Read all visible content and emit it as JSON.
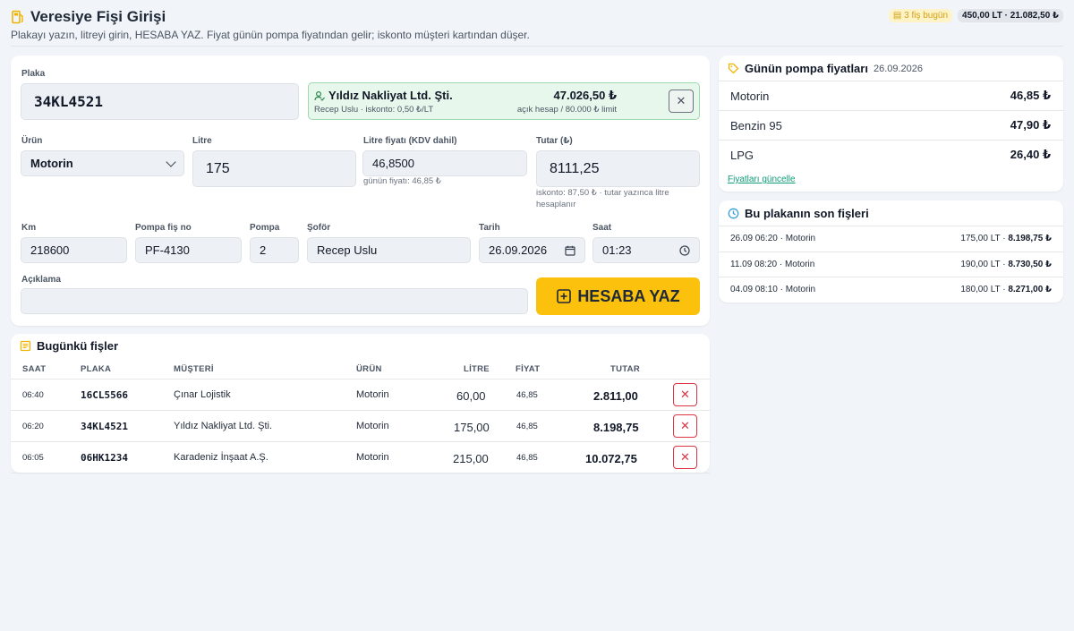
{
  "header": {
    "title": "Veresiye Fişi Girişi",
    "subtitle": "Plakayı yazın, litreyi girin, HESABA YAZ. Fiyat günün pompa fiyatından gelir; iskonto müşteri kartından düşer.",
    "chip_count": "3 fiş bugün",
    "chip_total": "450,00 LT · 21.082,50 ₺"
  },
  "form": {
    "plate_label": "Plaka",
    "plate_value": "34KL4521",
    "customer": {
      "name": "Yıldız Nakliyat Ltd. Şti.",
      "sub": "Recep Uslu · iskonto: 0,50 ₺/LT",
      "balance": "47.026,50 ₺",
      "limit": "açık hesap / 80.000 ₺ limit"
    },
    "product_label": "Ürün",
    "product_value": "Motorin",
    "litre_label": "Litre",
    "litre_value": "175",
    "unit_price_label": "Litre fiyatı (KDV dahil)",
    "unit_price_value": "46,8500",
    "unit_price_hint": "günün fiyatı: 46,85 ₺",
    "total_label": "Tutar (₺)",
    "total_value": "8111,25",
    "total_hint": "iskonto: 87,50 ₺ · tutar yazınca litre hesaplanır",
    "km_label": "Km",
    "km_value": "218600",
    "pump_slip_label": "Pompa fiş no",
    "pump_slip_value": "PF-4130",
    "pump_label": "Pompa",
    "pump_value": "2",
    "driver_label": "Şoför",
    "driver_value": "Recep Uslu",
    "date_label": "Tarih",
    "date_value": "26.09.2026",
    "time_label": "Saat",
    "time_value": "01:23",
    "note_label": "Açıklama",
    "note_value": "",
    "submit_label": "HESABA YAZ"
  },
  "prices": {
    "title": "Günün pompa fiyatları",
    "date": "26.09.2026",
    "items": [
      {
        "name": "Motorin",
        "price": "46,85 ₺"
      },
      {
        "name": "Benzin 95",
        "price": "47,90 ₺"
      },
      {
        "name": "LPG",
        "price": "26,40 ₺"
      }
    ],
    "update_link": "Fiyatları güncelle"
  },
  "recent": {
    "title": "Bu plakanın son fişleri",
    "items": [
      {
        "left": "26.09 06:20 · Motorin",
        "litre": "175,00 LT · ",
        "amount": "8.198,75 ₺"
      },
      {
        "left": "11.09 08:20 · Motorin",
        "litre": "190,00 LT · ",
        "amount": "8.730,50 ₺"
      },
      {
        "left": "04.09 08:10 · Motorin",
        "litre": "180,00 LT · ",
        "amount": "8.271,00 ₺"
      }
    ]
  },
  "today": {
    "title": "Bugünkü fişler",
    "columns": {
      "time": "SAAT",
      "plate": "PLAKA",
      "customer": "MÜŞTERİ",
      "product": "ÜRÜN",
      "litre": "LİTRE",
      "price": "FİYAT",
      "total": "TUTAR"
    },
    "rows": [
      {
        "time": "06:40",
        "plate": "16CL5566",
        "customer": "Çınar Lojistik",
        "product": "Motorin",
        "litre": "60,00",
        "price": "46,85",
        "total": "2.811,00"
      },
      {
        "time": "06:20",
        "plate": "34KL4521",
        "customer": "Yıldız Nakliyat Ltd. Şti.",
        "product": "Motorin",
        "litre": "175,00",
        "price": "46,85",
        "total": "8.198,75"
      },
      {
        "time": "06:05",
        "plate": "06HK1234",
        "customer": "Karadeniz İnşaat A.Ş.",
        "product": "Motorin",
        "litre": "215,00",
        "price": "46,85",
        "total": "10.072,75"
      }
    ]
  },
  "colors": {
    "accent_yellow": "#fbc10c",
    "success_green": "#9ed8ae",
    "danger_red": "#dc3545",
    "link_teal": "#0f9b76"
  }
}
